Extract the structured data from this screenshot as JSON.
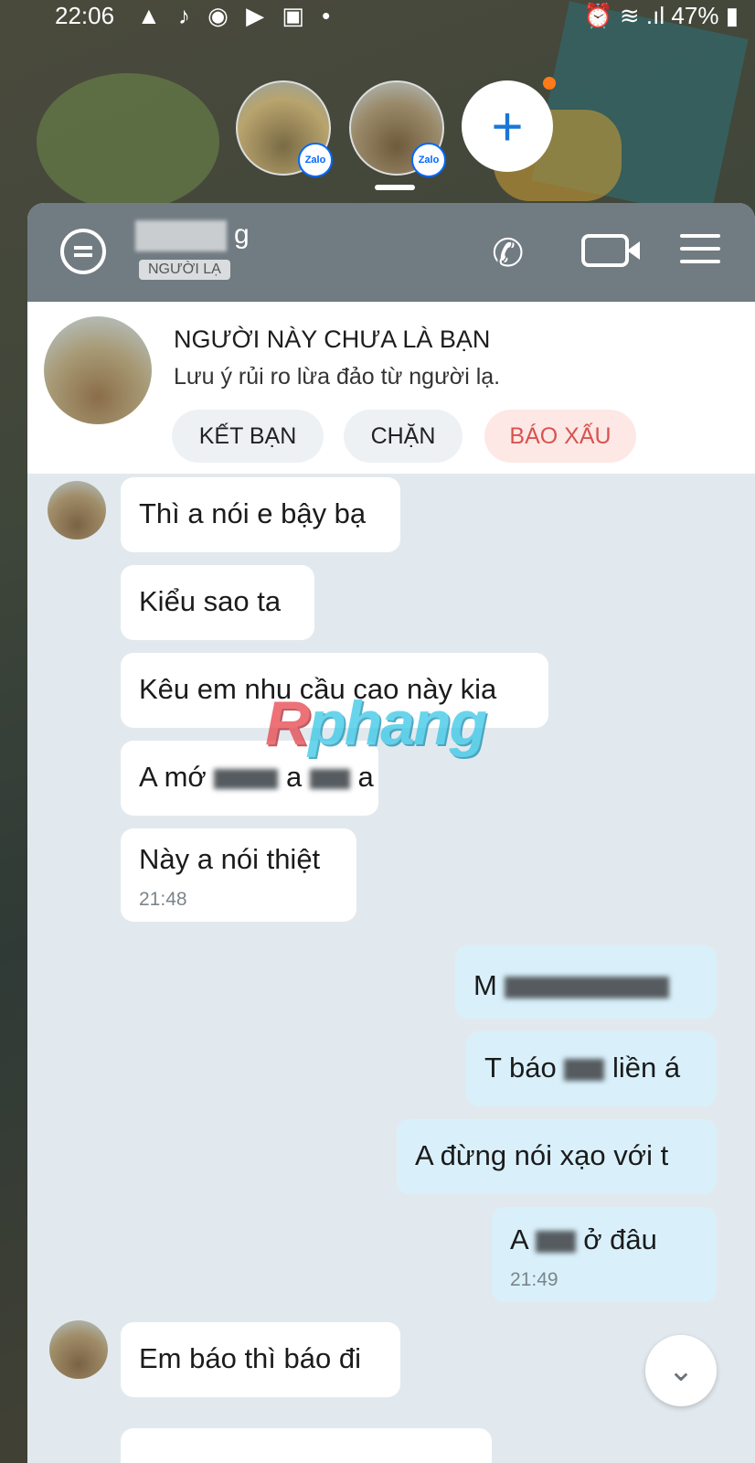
{
  "status_bar": {
    "time": "22:06",
    "left_icons": "▲ ♪ ◉ ▶ ▣ •",
    "right_icons": "⏰ ≋ .ıl",
    "battery": "47%"
  },
  "chat_heads": {
    "badge": "Zalo",
    "add_symbol": "+"
  },
  "header": {
    "name_suffix": "g",
    "stranger_badge": "NGƯỜI LẠ"
  },
  "stranger_card": {
    "title": "NGƯỜI NÀY CHƯA LÀ BẠN",
    "subtitle": "Lưu ý rủi ro lừa đảo từ người lạ.",
    "add_friend": "KẾT BẠN",
    "block": "CHẶN",
    "report": "BÁO XẤU"
  },
  "messages": [
    {
      "text": "Thì a nói e bậy bạ",
      "from": "them"
    },
    {
      "text": "Kiểu sao ta",
      "from": "them"
    },
    {
      "text": "Kêu em nhu cầu cao này kia",
      "from": "them"
    },
    {
      "text_start": "A mớ",
      "text_mid": "a",
      "text_end": "a",
      "from": "them"
    },
    {
      "text": "Này a nói thiệt",
      "time": "21:48",
      "from": "them"
    },
    {
      "text_start": "M",
      "from": "me"
    },
    {
      "text_start": "T báo",
      "text_end": "liền á",
      "from": "me"
    },
    {
      "text": "A đừng nói xạo với t",
      "from": "me"
    },
    {
      "text_start": "A",
      "text_end": "ở đâu",
      "time": "21:49",
      "from": "me"
    },
    {
      "text": "Em báo thì báo đi",
      "from": "them"
    }
  ],
  "watermark": {
    "first": "R",
    "rest": "phang"
  },
  "scroll_down_icon": "⌄"
}
